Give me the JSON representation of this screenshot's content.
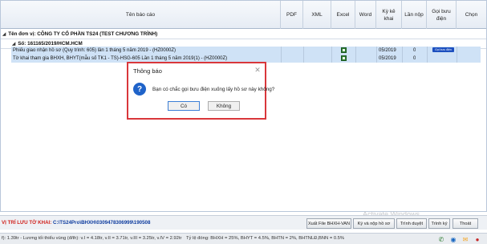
{
  "table": {
    "headers": {
      "title": "Tên báo cáo",
      "pdf": "PDF",
      "xml": "XML",
      "excel": "Excel",
      "word": "Word",
      "ky_ke_khai": "Kỳ kê khai",
      "lan_nop": "Lần nộp",
      "goi_buu_dien": "Gọi bưu điện",
      "chon": "Chọn"
    },
    "group_unit": "Tên đơn vị: CÔNG TY CỔ PHẦN TS24 (TEST CHƯƠNG TRÌNH)",
    "group_so": "Số: 161165/2019/HCM.HCM",
    "rows": [
      {
        "name": "Phiếu giao nhận hồ sơ (Quy trình: 605) lần 1 tháng 5 năm 2019 - (HZ0000Z)",
        "period": "05/2019",
        "times": "0",
        "post_button": "Gọi bưu điện"
      },
      {
        "name": "Tờ khai tham gia BHXH, BHYT(mẫu số TK1 - TS)-HSG-605 Lần 1 tháng 5 năm 2019(1) - (HZ0000Z)",
        "period": "05/2019",
        "times": "0",
        "post_button": ""
      }
    ]
  },
  "dialog": {
    "title": "Thông báo",
    "message": "Bạn có chắc gọi bưu điện xuống lấy hồ sơ này không?",
    "ok": "Có",
    "no": "Không",
    "icon": "question-icon"
  },
  "status": {
    "label": "VỊ TRÍ LƯU TỜ KHAI:",
    "path": "C:\\TS24Pro\\BHXH\\0309478306999\\190508"
  },
  "actions": {
    "export_van": "Xuất File BHXH-VAN",
    "sign_submit": "Ký và nộp hồ sơ",
    "submit_approve": "Trình duyệt",
    "tra_ky": "Trình ký",
    "exit": "Thoát"
  },
  "watermark": "Activate Windows",
  "info": {
    "left": "f): 1.39tr - Lương tối thiểu vùng (đ/th): v.I = 4.18tr, v.II = 3.71tr, v.III = 3.25tr, v.IV = 2.92tr",
    "rates": "Tỷ lệ đóng: BHXH = 25%, BHYT = 4.5%, BHTN = 2%, BHTNLĐ,BNN = 0.5%"
  },
  "colors": {
    "accent": "#1f63c9",
    "dialog_border": "#d9373b",
    "status_label": "#d0211c",
    "status_path": "#0d3b9e",
    "row_selected": "#cfe2f6"
  }
}
